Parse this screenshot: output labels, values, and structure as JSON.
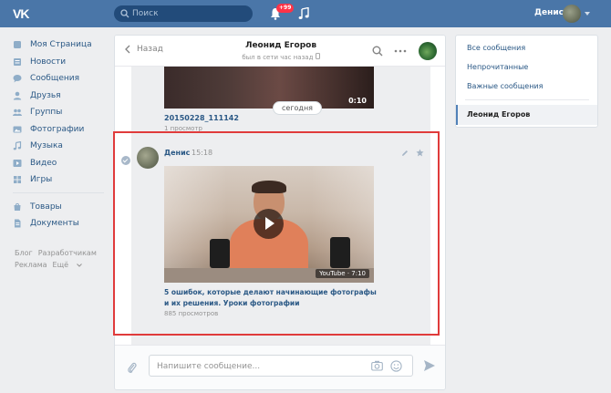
{
  "topbar": {
    "logo": "VK",
    "search_placeholder": "Поиск",
    "notifications_badge": "+99",
    "user_name": "Денис"
  },
  "leftnav": {
    "items": [
      {
        "label": "Моя Страница",
        "icon": "home-icon"
      },
      {
        "label": "Новости",
        "icon": "news-icon"
      },
      {
        "label": "Сообщения",
        "icon": "messages-icon"
      },
      {
        "label": "Друзья",
        "icon": "friends-icon"
      },
      {
        "label": "Группы",
        "icon": "groups-icon"
      },
      {
        "label": "Фотографии",
        "icon": "photos-icon"
      },
      {
        "label": "Музыка",
        "icon": "music-icon"
      },
      {
        "label": "Видео",
        "icon": "video-icon"
      },
      {
        "label": "Игры",
        "icon": "games-icon"
      }
    ],
    "items2": [
      {
        "label": "Товары",
        "icon": "goods-icon"
      },
      {
        "label": "Документы",
        "icon": "documents-icon"
      }
    ],
    "footer": {
      "blog": "Блог",
      "developers": "Разработчикам",
      "ads": "Реклама",
      "more": "Ещё"
    }
  },
  "chat": {
    "back_label": "Назад",
    "title": "Леонид Егоров",
    "subtitle": "был в сети час назад",
    "date_pill": "сегодня",
    "prev_video": {
      "duration": "0:10",
      "name": "20150228_111142",
      "views": "1 просмотр"
    },
    "message": {
      "author": "Денис",
      "time": "15:18",
      "video_badge": "YouTube · 7:10",
      "video_title": "5 ошибок, которые делают начинающие фотографы и их решения. Уроки фотографии",
      "video_views": "885 просмотров"
    },
    "composer_placeholder": "Напишите сообщение..."
  },
  "right": {
    "all": "Все сообщения",
    "unread": "Непрочитанные",
    "important": "Важные сообщения",
    "active": "Леонид Егоров"
  },
  "colors": {
    "brand": "#4a76a8",
    "link": "#2a5885",
    "highlight": "#e03b3b"
  }
}
